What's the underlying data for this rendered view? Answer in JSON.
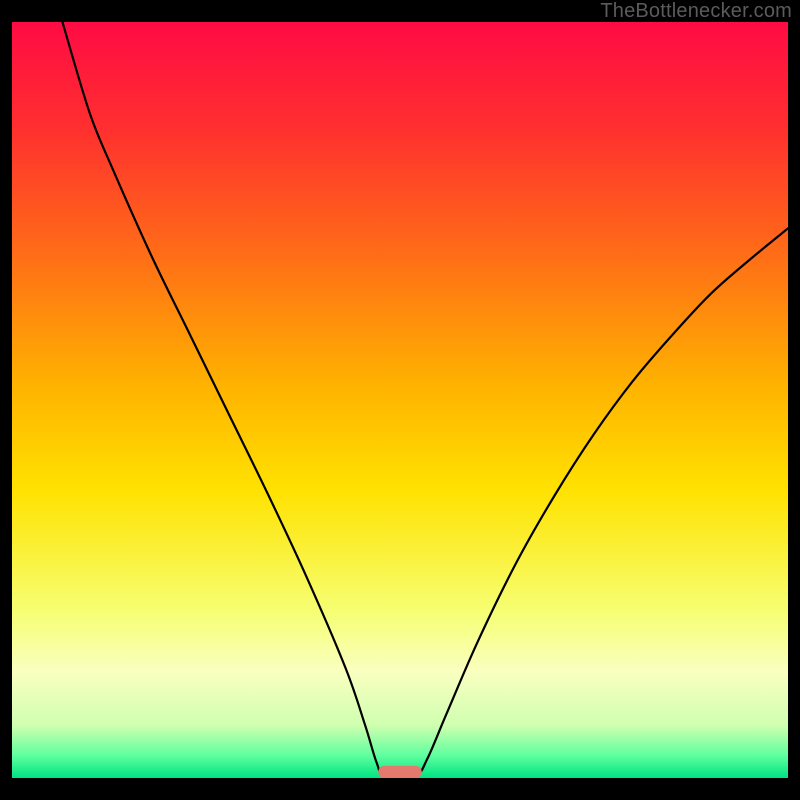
{
  "watermark": "TheBottlenecker.com",
  "chart_data": {
    "type": "line",
    "title": "",
    "xlabel": "",
    "ylabel": "",
    "xlim": [
      0,
      100
    ],
    "ylim": [
      0,
      100
    ],
    "gradient_stops": [
      {
        "offset": 0.0,
        "color": "#ff0b44"
      },
      {
        "offset": 0.14,
        "color": "#ff2f2f"
      },
      {
        "offset": 0.3,
        "color": "#ff6a18"
      },
      {
        "offset": 0.48,
        "color": "#ffb200"
      },
      {
        "offset": 0.62,
        "color": "#ffe200"
      },
      {
        "offset": 0.78,
        "color": "#f6ff73"
      },
      {
        "offset": 0.86,
        "color": "#f9ffc0"
      },
      {
        "offset": 0.93,
        "color": "#d0ffb0"
      },
      {
        "offset": 0.97,
        "color": "#60ff9f"
      },
      {
        "offset": 1.0,
        "color": "#00e481"
      }
    ],
    "curve": [
      {
        "x": 6.5,
        "y": 100.0
      },
      {
        "x": 10.0,
        "y": 88.0
      },
      {
        "x": 13.0,
        "y": 80.5
      },
      {
        "x": 18.0,
        "y": 69.0
      },
      {
        "x": 23.0,
        "y": 58.5
      },
      {
        "x": 28.0,
        "y": 48.0
      },
      {
        "x": 33.0,
        "y": 37.5
      },
      {
        "x": 38.0,
        "y": 26.5
      },
      {
        "x": 43.0,
        "y": 14.5
      },
      {
        "x": 45.5,
        "y": 7.0
      },
      {
        "x": 47.0,
        "y": 2.0
      },
      {
        "x": 48.0,
        "y": 0.4
      },
      {
        "x": 52.0,
        "y": 0.4
      },
      {
        "x": 53.5,
        "y": 2.5
      },
      {
        "x": 56.0,
        "y": 8.5
      },
      {
        "x": 60.0,
        "y": 18.0
      },
      {
        "x": 65.0,
        "y": 28.5
      },
      {
        "x": 70.0,
        "y": 37.5
      },
      {
        "x": 75.0,
        "y": 45.5
      },
      {
        "x": 80.0,
        "y": 52.5
      },
      {
        "x": 85.0,
        "y": 58.5
      },
      {
        "x": 90.0,
        "y": 64.0
      },
      {
        "x": 95.0,
        "y": 68.5
      },
      {
        "x": 100.0,
        "y": 72.7
      }
    ],
    "marker": {
      "x_center": 50.0,
      "y": 0.0,
      "half_width": 2.8,
      "height": 1.6,
      "color": "#e47a6e"
    }
  }
}
